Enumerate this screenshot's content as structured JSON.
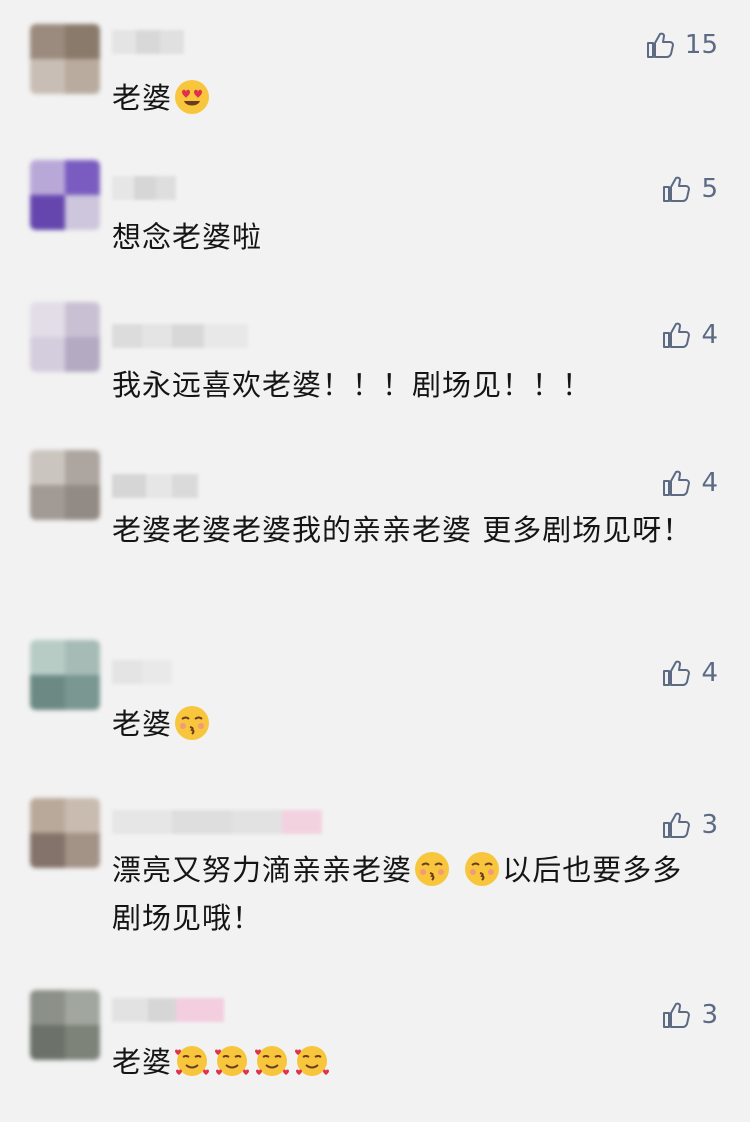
{
  "comments": [
    {
      "likes": "15",
      "text": "老婆",
      "emojis": [
        "heart-eyes",
        ""
      ],
      "avatar": [
        "#9b8b7e",
        "#8a7a6c",
        "#c8beb5",
        "#b9ab9e"
      ],
      "nick": [
        "#dcdcdc",
        "#cfcfcf",
        "#e2e2e2"
      ]
    },
    {
      "likes": "5",
      "text": "想念老婆啦",
      "avatar": [
        "#6a4fb0",
        "#8467c8",
        "#5539a1",
        "#b9b0cf"
      ],
      "nick": [
        "#dedede",
        "#d2d2d2",
        "#e0e0e0"
      ]
    },
    {
      "likes": "4",
      "text": "我永远喜欢老婆！！！剧场见！！！",
      "avatar": [
        "#cfc8d6",
        "#b5abc3",
        "#ddd8e3",
        "#c2b9cf"
      ],
      "nick": [
        "#d8d8d8",
        "#e3e3e3",
        "#d1d1d1",
        "#e6e6e6"
      ]
    },
    {
      "likes": "4",
      "text": "老婆老婆老婆我的亲亲老婆 更多剧场见呀！",
      "avatar": [
        "#b7b0aa",
        "#a29a94",
        "#c9c3be",
        "#8f8983"
      ],
      "nick": [
        "#d4d4d4",
        "#e5e5e5",
        "#d9d9d9"
      ]
    },
    {
      "likes": "4",
      "text": "老婆",
      "avatar": [
        "#a7bdb7",
        "#7f9b95",
        "#6f8c85",
        "#c6d5d1"
      ],
      "nick": [
        "#dddddd",
        "#e6e6e6"
      ]
    },
    {
      "likes": "3",
      "text": "漂亮又努力滴亲亲老婆",
      "text2": "以后也要多多剧场见哦！",
      "avatar": [
        "#a69587",
        "#7f6d60",
        "#c7b9ad",
        "#94847a"
      ],
      "nick": [
        "#dcdcdc",
        "#e2e2e2",
        "#d6d6d6",
        "#eeccdd"
      ]
    },
    {
      "likes": "3",
      "text": "老婆",
      "avatar": [
        "#8d928a",
        "#6e746c",
        "#9fa49c",
        "#7c8279"
      ],
      "nick": [
        "#dedede",
        "#d4d4d4",
        "#f0c8d8"
      ]
    }
  ],
  "icons": {
    "like": "thumbs-up-icon"
  },
  "colors": {
    "like": "#5d6a84",
    "text": "#151515",
    "background": "#f2f2f2"
  }
}
